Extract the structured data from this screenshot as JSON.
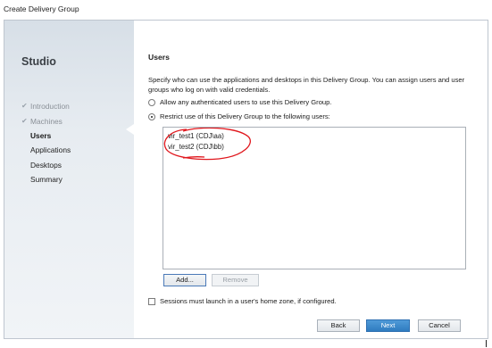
{
  "window": {
    "title": "Create Delivery Group"
  },
  "sidebar": {
    "studio_label": "Studio",
    "items": [
      {
        "label": "Introduction",
        "state": "done"
      },
      {
        "label": "Machines",
        "state": "done"
      },
      {
        "label": "Users",
        "state": "current"
      },
      {
        "label": "Applications",
        "state": "todo"
      },
      {
        "label": "Desktops",
        "state": "todo"
      },
      {
        "label": "Summary",
        "state": "todo"
      }
    ]
  },
  "main": {
    "heading": "Users",
    "description": "Specify who can use the applications and desktops in this Delivery Group. You can assign users and user groups who log on with valid credentials.",
    "options": [
      {
        "label": "Allow any authenticated users to use this Delivery Group.",
        "selected": false
      },
      {
        "label": "Restrict use of this Delivery Group to the following users:",
        "selected": true
      }
    ],
    "users": [
      "vir_test1 (CDJ\\aa)",
      "vir_test2 (CDJ\\bb)"
    ],
    "add_label": "Add...",
    "remove_label": "Remove",
    "home_zone_label": "Sessions must launch in a user's home zone, if configured.",
    "home_zone_checked": false
  },
  "footer": {
    "back_label": "Back",
    "next_label": "Next",
    "cancel_label": "Cancel"
  },
  "colors": {
    "accent": "#2f7cc0",
    "annotation": "#e0171d"
  }
}
